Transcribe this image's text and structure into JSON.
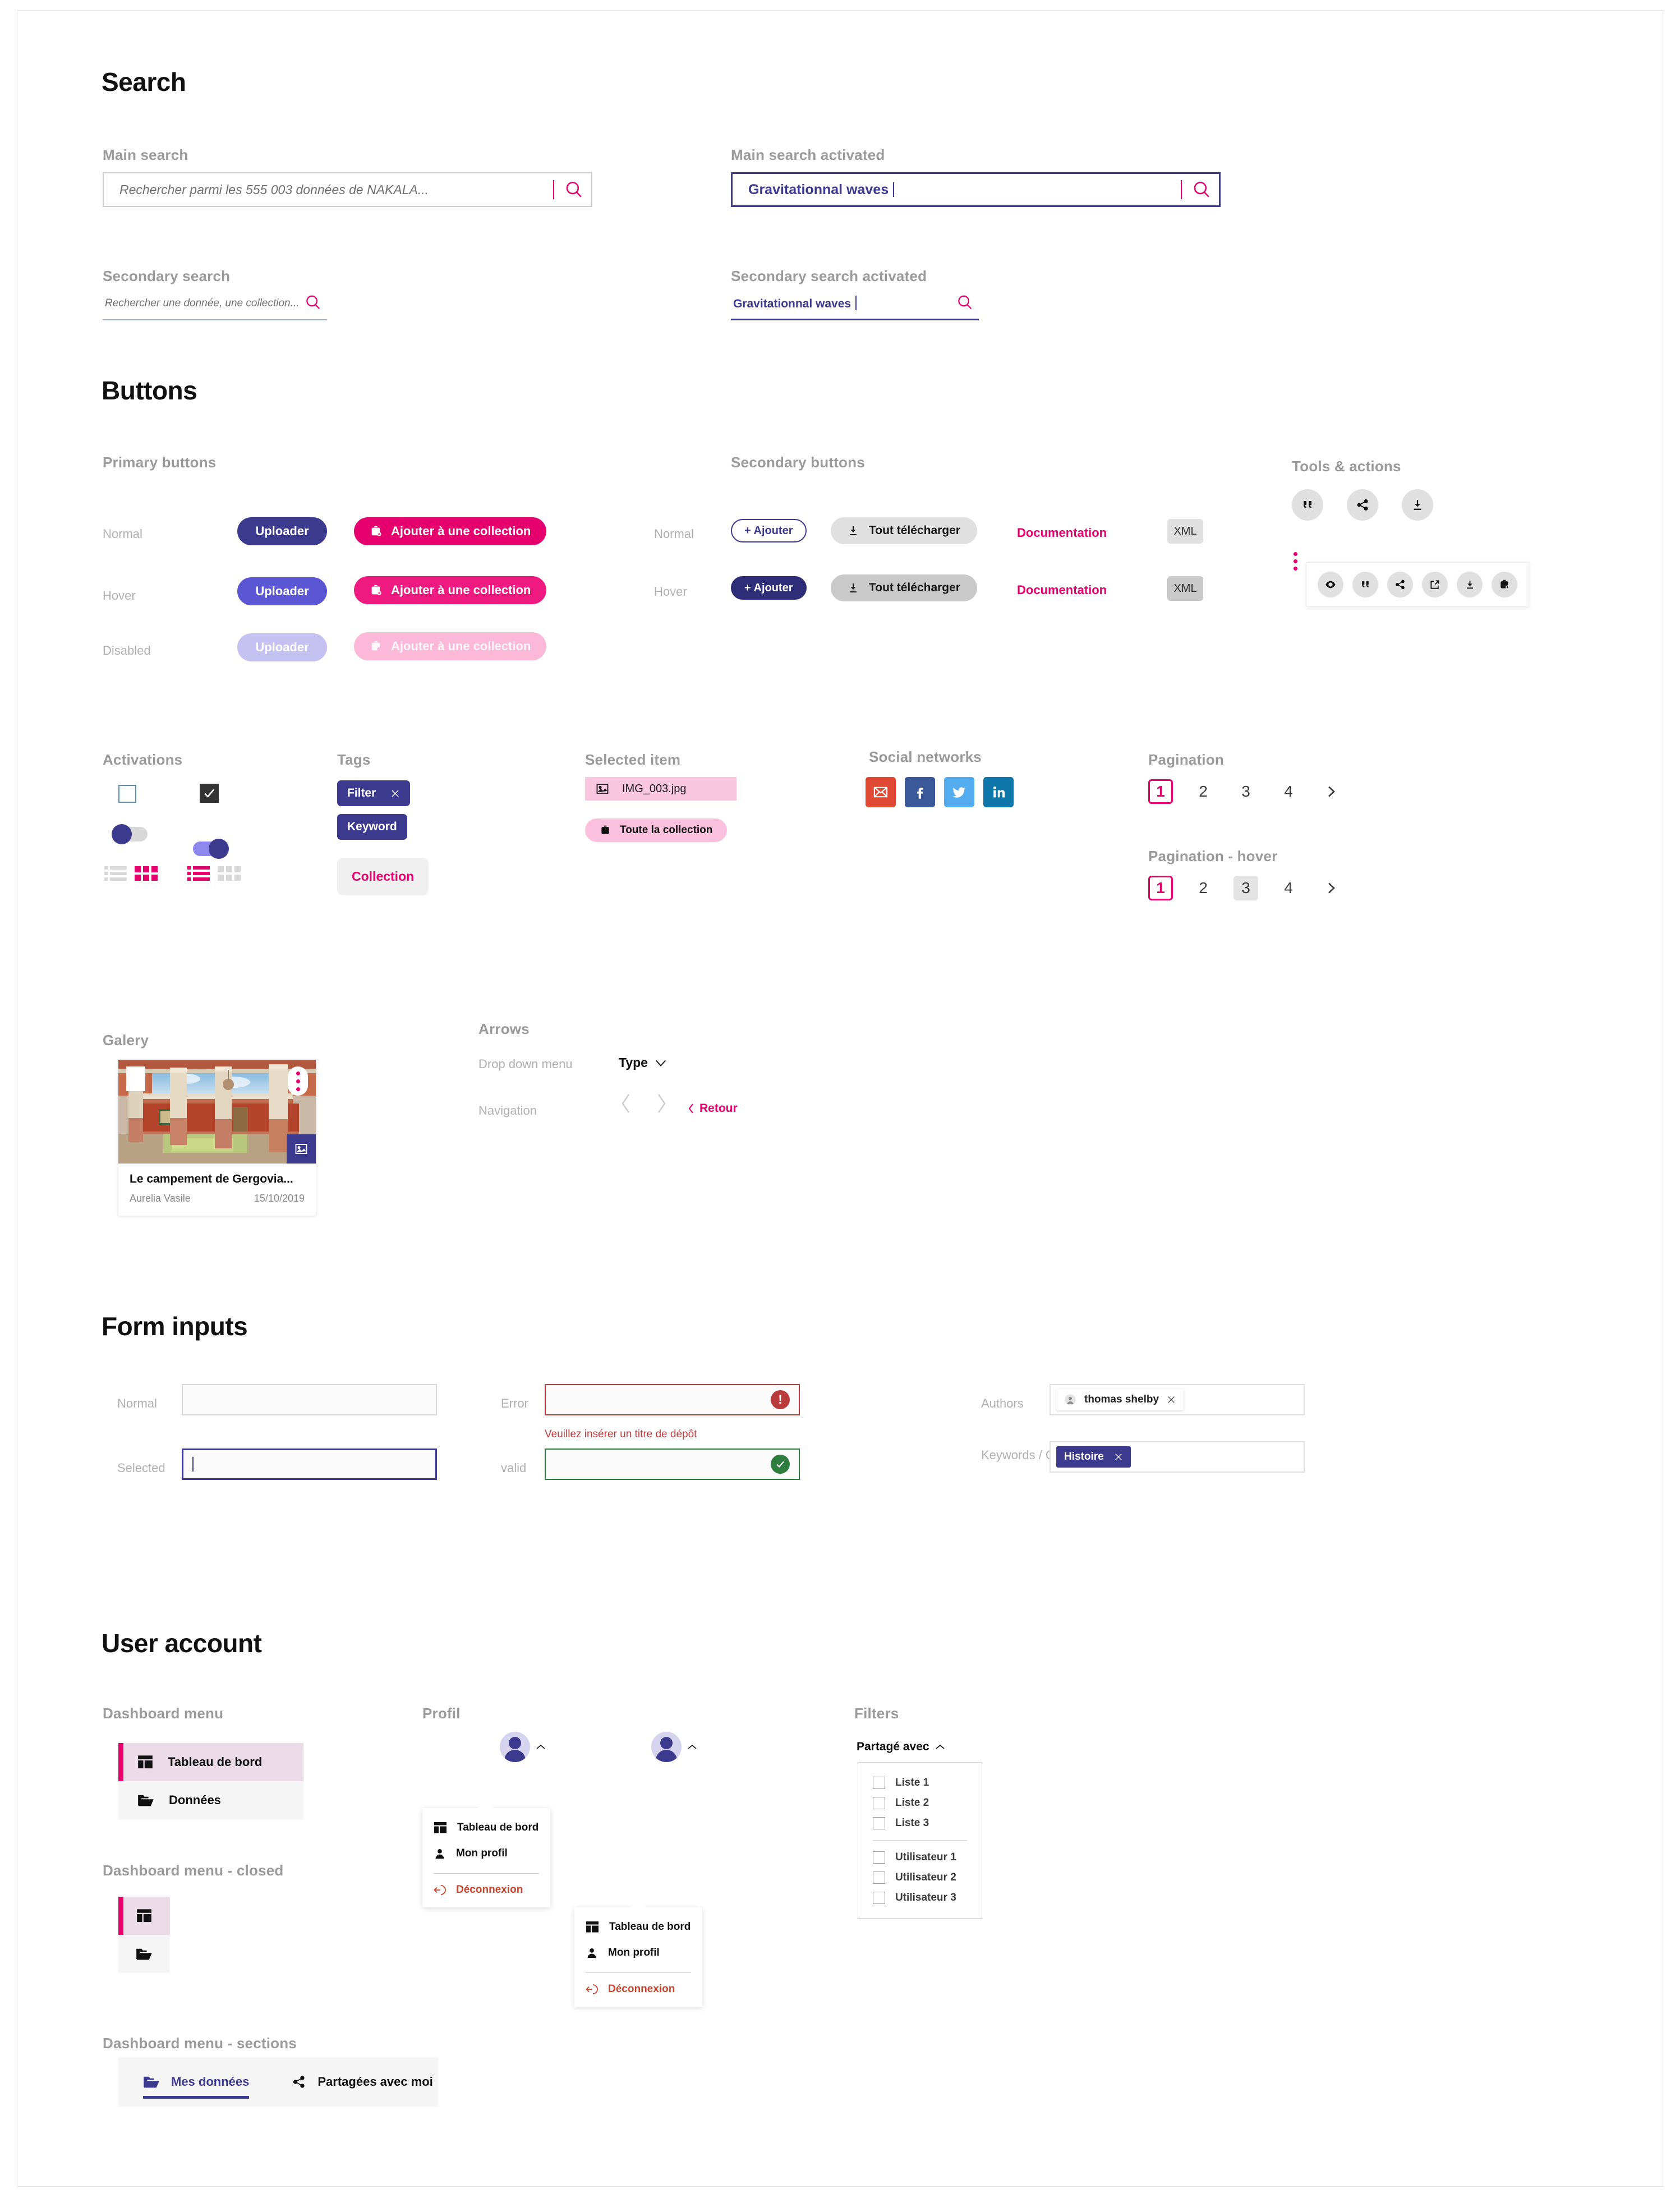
{
  "sections": {
    "search": "Search",
    "buttons": "Buttons",
    "form_inputs": "Form inputs",
    "user_account": "User account"
  },
  "search": {
    "main_label": "Main search",
    "main_placeholder": "Rechercher parmi les 555 003 données de NAKALA...",
    "main_active_label": "Main search activated",
    "main_active_value": "Gravitationnal waves",
    "secondary_label": "Secondary search",
    "secondary_placeholder": "Rechercher une donnée, une collection...",
    "secondary_active_label": "Secondary search activated",
    "secondary_active_value": "Gravitationnal waves",
    "icon": "search-icon"
  },
  "buttons": {
    "primary_label": "Primary buttons",
    "secondary_label": "Secondary buttons",
    "tools_label": "Tools & actions",
    "states": {
      "normal": "Normal",
      "hover": "Hover",
      "disabled": "Disabled"
    },
    "uploader": "Uploader",
    "add_collection": "Ajouter à une collection",
    "ajouter": "+ Ajouter",
    "download_all": "Tout télécharger",
    "documentation": "Documentation",
    "xml": "XML",
    "tool_icons": [
      "quote-icon",
      "share-icon",
      "download-icon"
    ],
    "toolbar_icons": [
      "eye-icon",
      "quote-icon",
      "share-icon",
      "external-link-icon",
      "download-icon",
      "add-to-collection-icon"
    ]
  },
  "activations": {
    "label": "Activations",
    "checkbox_unchecked": "checkbox-unchecked",
    "checkbox_checked": "checkbox-checked",
    "toggle_off": "toggle-off",
    "toggle_on": "toggle-on",
    "view_list_icon": "list-view-icon",
    "view_grid_icon": "grid-view-icon"
  },
  "tags": {
    "label": "Tags",
    "filter": "Filter",
    "keyword": "Keyword",
    "collection": "Collection",
    "close_icon": "close-icon"
  },
  "selected_item": {
    "label": "Selected item",
    "file_name": "IMG_003.jpg",
    "file_icon": "image-icon",
    "whole_collection": "Toute la collection",
    "collection_icon": "collection-icon"
  },
  "social": {
    "label": "Social networks",
    "networks": [
      {
        "name": "email-icon",
        "color": "#e04a35"
      },
      {
        "name": "facebook-icon",
        "color": "#3b5998"
      },
      {
        "name": "twitter-icon",
        "color": "#55acee"
      },
      {
        "name": "linkedin-icon",
        "color": "#0e76a8"
      }
    ]
  },
  "pagination": {
    "label": "Pagination",
    "hover_label": "Pagination - hover",
    "pages": [
      "1",
      "2",
      "3",
      "4"
    ],
    "current": "1",
    "hovered": "3",
    "next_icon": "chevron-right-icon"
  },
  "gallery": {
    "label": "Galery",
    "card_title": "Le campement de Gergovia...",
    "card_author": "Aurelia Vasile",
    "card_date": "15/10/2019",
    "type_icon": "image-type-icon",
    "menu_icon": "kebab-menu-icon",
    "select_icon": "select-checkbox-icon"
  },
  "arrows": {
    "label": "Arrows",
    "dropdown_label": "Drop down menu",
    "dropdown_value": "Type",
    "navigation_label": "Navigation",
    "back": "Retour",
    "prev_icon": "chevron-left-icon",
    "next_icon": "chevron-right-icon",
    "chevron_down_icon": "chevron-down-icon"
  },
  "form": {
    "normal": "Normal",
    "selected": "Selected",
    "error": "Error",
    "valid": "valid",
    "error_message": "Veuillez insérer un titre de dépôt",
    "error_icon": "error-icon",
    "valid_icon": "check-icon",
    "authors_label": "Authors",
    "author_chip": "thomas shelby",
    "author_icon": "person-icon",
    "keywords_label": "Keywords / Categories",
    "keyword_chip": "Histoire",
    "remove_icon": "close-icon"
  },
  "user_account": {
    "dashboard_menu_label": "Dashboard menu",
    "dashboard_menu_closed_label": "Dashboard menu - closed",
    "dashboard_menu_sections_label": "Dashboard menu - sections",
    "profil_label": "Profil",
    "filters_label": "Filters",
    "menu_items": [
      {
        "label": "Tableau de bord",
        "icon": "dashboard-icon",
        "active": true
      },
      {
        "label": "Données",
        "icon": "folder-icon",
        "active": false
      }
    ],
    "profile_menu": [
      {
        "label": "Tableau de bord",
        "icon": "dashboard-icon"
      },
      {
        "label": "Mon profil",
        "icon": "person-icon"
      }
    ],
    "logout": "Déconnexion",
    "logout_icon": "logout-icon",
    "filters_header": "Partagé avec",
    "filters_chevron_icon": "chevron-up-icon",
    "filter_lists": [
      "Liste 1",
      "Liste 2",
      "Liste 3"
    ],
    "filter_users": [
      "Utilisateur 1",
      "Utilisateur 2",
      "Utilisateur 3"
    ],
    "sections": [
      {
        "label": "Mes données",
        "icon": "folder-icon",
        "active": true
      },
      {
        "label": "Partagées avec moi",
        "icon": "share-icon",
        "active": false
      }
    ]
  },
  "colors": {
    "primary": "#3b3a8f",
    "primary_hover": "#5b56d4",
    "accent": "#e5006d",
    "error": "#b93b3b",
    "valid": "#2e7d3e",
    "muted": "#9a9a9a"
  }
}
